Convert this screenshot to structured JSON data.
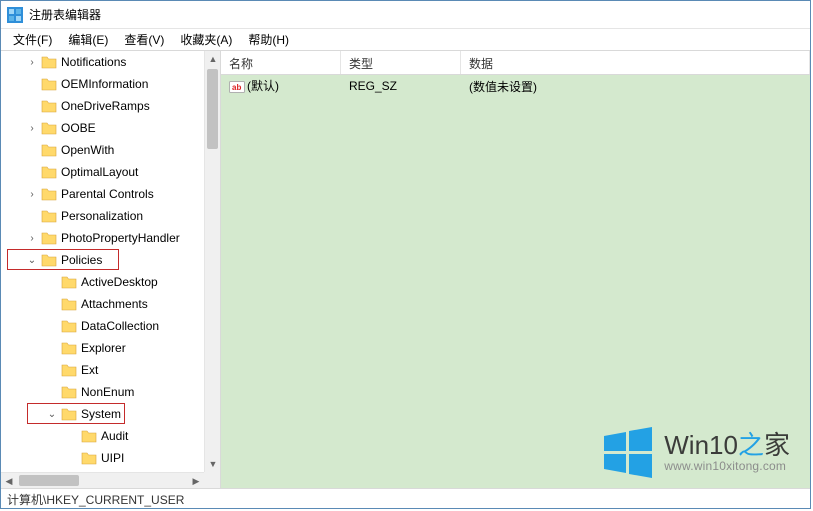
{
  "window": {
    "title": "注册表编辑器"
  },
  "menu": {
    "file": "文件(F)",
    "edit": "编辑(E)",
    "view": "查看(V)",
    "favorites": "收藏夹(A)",
    "help": "帮助(H)"
  },
  "tree": {
    "items": [
      {
        "label": "Notifications",
        "depth": 1,
        "toggle": ">"
      },
      {
        "label": "OEMInformation",
        "depth": 1,
        "toggle": ""
      },
      {
        "label": "OneDriveRamps",
        "depth": 1,
        "toggle": ""
      },
      {
        "label": "OOBE",
        "depth": 1,
        "toggle": ">"
      },
      {
        "label": "OpenWith",
        "depth": 1,
        "toggle": ""
      },
      {
        "label": "OptimalLayout",
        "depth": 1,
        "toggle": ""
      },
      {
        "label": "Parental Controls",
        "depth": 1,
        "toggle": ">"
      },
      {
        "label": "Personalization",
        "depth": 1,
        "toggle": ""
      },
      {
        "label": "PhotoPropertyHandler",
        "depth": 1,
        "toggle": ">"
      },
      {
        "label": "Policies",
        "depth": 1,
        "toggle": "v",
        "hl": true
      },
      {
        "label": "ActiveDesktop",
        "depth": 2,
        "toggle": ""
      },
      {
        "label": "Attachments",
        "depth": 2,
        "toggle": ""
      },
      {
        "label": "DataCollection",
        "depth": 2,
        "toggle": ""
      },
      {
        "label": "Explorer",
        "depth": 2,
        "toggle": ""
      },
      {
        "label": "Ext",
        "depth": 2,
        "toggle": ""
      },
      {
        "label": "NonEnum",
        "depth": 2,
        "toggle": ""
      },
      {
        "label": "System",
        "depth": 2,
        "toggle": "v",
        "hl": true
      },
      {
        "label": "Audit",
        "depth": 3,
        "toggle": ""
      },
      {
        "label": "UIPI",
        "depth": 3,
        "toggle": ""
      }
    ]
  },
  "list": {
    "columns": {
      "name": "名称",
      "type": "类型",
      "data": "数据"
    },
    "rows": [
      {
        "name": "(默认)",
        "type": "REG_SZ",
        "data": "(数值未设置)",
        "icon": "string-value-icon"
      }
    ]
  },
  "status": {
    "path": "计算机\\HKEY_CURRENT_USER"
  },
  "watermark": {
    "line1a": "Win10",
    "line1b": "之",
    "line1c": "家",
    "line2": "www.win10xitong.com"
  }
}
